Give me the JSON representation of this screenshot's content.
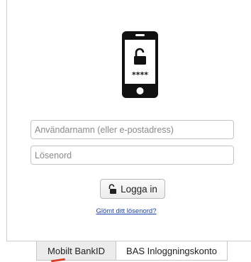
{
  "icons": {
    "phone": "smartphone-unlock-icon",
    "phone_code": "****",
    "login_lock": "unlocked-padlock-icon"
  },
  "form": {
    "username_placeholder": "Användarnamn (eller e-postadress)",
    "password_placeholder": "Lösenord",
    "login_label": "Logga in",
    "forgot_label": "Glömt ditt lösenord?"
  },
  "tabs": [
    {
      "label": "Mobilt BankID",
      "selected": false
    },
    {
      "label": "BAS Inloggningskonto",
      "selected": true
    }
  ],
  "colors": {
    "link": "#1a3fb0",
    "accent_mark": "#d8402c"
  }
}
